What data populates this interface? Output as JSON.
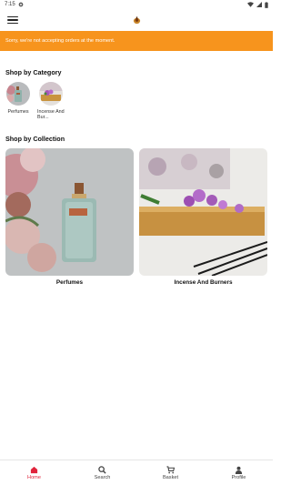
{
  "status_bar": {
    "time": "7:15"
  },
  "banner": {
    "text": "Sorry, we're not accepting orders at the moment."
  },
  "sections": {
    "category_title": "Shop by Category",
    "collection_title": "Shop by Collection"
  },
  "categories": [
    {
      "label": "Perfumes"
    },
    {
      "label": "Incense And Bur..."
    }
  ],
  "collections": [
    {
      "label": "Perfumes"
    },
    {
      "label": "Incense And Burners"
    }
  ],
  "bottom_nav": [
    {
      "label": "Home",
      "icon": "home-icon",
      "active": true
    },
    {
      "label": "Search",
      "icon": "search-icon"
    },
    {
      "label": "Basket",
      "icon": "cart-icon"
    },
    {
      "label": "Profile",
      "icon": "person-icon"
    }
  ],
  "colors": {
    "banner": "#f7941d",
    "active_nav": "#e0243c"
  }
}
